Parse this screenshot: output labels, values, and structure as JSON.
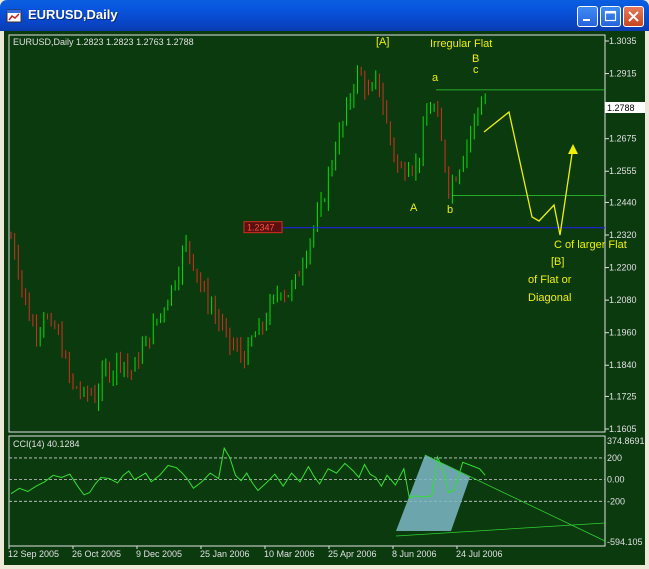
{
  "window": {
    "title": "EURUSD,Daily",
    "app_icon": "chart-window-icon",
    "buttons": [
      "minimize-icon",
      "maximize-icon",
      "close-icon"
    ]
  },
  "colors": {
    "background": "#0b3a0f",
    "bull": "#00e000",
    "bear": "#d03020",
    "annotation": "#f0f000",
    "support_line": "#2222dd",
    "cci_line": "#30e030",
    "cci_fill": "#7fb8c8"
  },
  "main_panel": {
    "header": "EURUSD,Daily  1.2823 1.2823 1.2763 1.2788",
    "price_ticks": [
      "1.3035",
      "1.2915",
      "1.2788",
      "1.2675",
      "1.2555",
      "1.2440",
      "1.2320",
      "1.2200",
      "1.2080",
      "1.1960",
      "1.1840",
      "1.1725",
      "1.1605"
    ],
    "current_price": "1.2788",
    "hline_label": "1.2347",
    "annotations": {
      "wave_A_bracket": "[A]",
      "irregular_flat": "Irregular Flat",
      "wave_a": "a",
      "wave_b_upper": "B",
      "wave_c": "c",
      "wave_A": "A",
      "wave_b": "b",
      "c_larger_flat": "C of larger Flat",
      "wave_B_bracket": "[B]",
      "of_flat_or": "of Flat or",
      "diagonal": "Diagonal"
    }
  },
  "cci_panel": {
    "header": "CCI(14) 40.1284",
    "ticks": [
      "374.8691",
      "200",
      "0.00",
      "-200",
      "-594.105"
    ]
  },
  "x_axis": {
    "dates": [
      "12 Sep 2005",
      "26 Oct 2005",
      "9 Dec 2005",
      "25 Jan 2006",
      "10 Mar 2006",
      "25 Apr 2006",
      "8 Jun 2006",
      "24 Jul 2006"
    ]
  },
  "chart_data": {
    "type": "candlestick",
    "symbol": "EURUSD",
    "timeframe": "Daily",
    "ylim": [
      1.1605,
      1.3035
    ],
    "cci_ylim": [
      -594.105,
      374.8691
    ],
    "horizontal_line": 1.2347,
    "path": [
      [
        0,
        1.231
      ],
      [
        4,
        1.224
      ],
      [
        8,
        1.212
      ],
      [
        12,
        1.204
      ],
      [
        16,
        1.198
      ],
      [
        20,
        1.197
      ],
      [
        24,
        1.205
      ],
      [
        28,
        1.196
      ],
      [
        32,
        1.198
      ],
      [
        36,
        1.191
      ],
      [
        40,
        1.183
      ],
      [
        44,
        1.175
      ],
      [
        48,
        1.176
      ],
      [
        52,
        1.172
      ],
      [
        56,
        1.175
      ],
      [
        60,
        1.172
      ],
      [
        64,
        1.178
      ],
      [
        68,
        1.183
      ],
      [
        72,
        1.181
      ],
      [
        76,
        1.187
      ],
      [
        80,
        1.186
      ],
      [
        84,
        1.181
      ],
      [
        88,
        1.183
      ],
      [
        92,
        1.189
      ],
      [
        96,
        1.192
      ],
      [
        100,
        1.196
      ],
      [
        104,
        1.201
      ],
      [
        108,
        1.204
      ],
      [
        112,
        1.21
      ],
      [
        116,
        1.214
      ],
      [
        120,
        1.221
      ],
      [
        124,
        1.229
      ],
      [
        128,
        1.225
      ],
      [
        132,
        1.219
      ],
      [
        136,
        1.212
      ],
      [
        140,
        1.208
      ],
      [
        144,
        1.205
      ],
      [
        148,
        1.2
      ],
      [
        152,
        1.196
      ],
      [
        156,
        1.192
      ],
      [
        160,
        1.19
      ],
      [
        164,
        1.188
      ],
      [
        168,
        1.187
      ],
      [
        172,
        1.194
      ],
      [
        176,
        1.196
      ],
      [
        180,
        1.199
      ],
      [
        184,
        1.205
      ],
      [
        188,
        1.208
      ],
      [
        192,
        1.213
      ],
      [
        196,
        1.21
      ],
      [
        200,
        1.212
      ],
      [
        204,
        1.216
      ],
      [
        208,
        1.223
      ],
      [
        212,
        1.229
      ],
      [
        216,
        1.235
      ],
      [
        220,
        1.24
      ],
      [
        224,
        1.248
      ],
      [
        228,
        1.258
      ],
      [
        232,
        1.266
      ],
      [
        236,
        1.272
      ],
      [
        240,
        1.279
      ],
      [
        244,
        1.288
      ],
      [
        248,
        1.292
      ],
      [
        252,
        1.288
      ],
      [
        256,
        1.282
      ],
      [
        260,
        1.289
      ],
      [
        264,
        1.284
      ],
      [
        268,
        1.272
      ],
      [
        272,
        1.264
      ],
      [
        276,
        1.256
      ],
      [
        280,
        1.256
      ],
      [
        284,
        1.26
      ],
      [
        288,
        1.256
      ],
      [
        292,
        1.264
      ],
      [
        296,
        1.276
      ],
      [
        300,
        1.281
      ],
      [
        304,
        1.274
      ],
      [
        308,
        1.262
      ],
      [
        312,
        1.25
      ],
      [
        316,
        1.253
      ],
      [
        320,
        1.258
      ],
      [
        324,
        1.265
      ],
      [
        328,
        1.271
      ],
      [
        332,
        1.277
      ],
      [
        336,
        1.283
      ],
      [
        340,
        1.279
      ]
    ],
    "cci": [
      [
        0,
        -130
      ],
      [
        6,
        -80
      ],
      [
        12,
        -110
      ],
      [
        18,
        -60
      ],
      [
        24,
        -20
      ],
      [
        30,
        40
      ],
      [
        36,
        20
      ],
      [
        42,
        50
      ],
      [
        48,
        -70
      ],
      [
        52,
        -140
      ],
      [
        56,
        -120
      ],
      [
        60,
        -40
      ],
      [
        64,
        20
      ],
      [
        70,
        10
      ],
      [
        76,
        -30
      ],
      [
        80,
        40
      ],
      [
        84,
        80
      ],
      [
        88,
        0
      ],
      [
        92,
        30
      ],
      [
        96,
        60
      ],
      [
        100,
        -20
      ],
      [
        106,
        40
      ],
      [
        112,
        130
      ],
      [
        118,
        110
      ],
      [
        122,
        60
      ],
      [
        126,
        0
      ],
      [
        130,
        -80
      ],
      [
        136,
        -20
      ],
      [
        142,
        60
      ],
      [
        148,
        10
      ],
      [
        152,
        290
      ],
      [
        156,
        200
      ],
      [
        160,
        40
      ],
      [
        164,
        -10
      ],
      [
        168,
        60
      ],
      [
        172,
        -30
      ],
      [
        176,
        -100
      ],
      [
        182,
        -30
      ],
      [
        188,
        50
      ],
      [
        194,
        -60
      ],
      [
        200,
        60
      ],
      [
        206,
        -20
      ],
      [
        212,
        120
      ],
      [
        216,
        30
      ],
      [
        220,
        -40
      ],
      [
        226,
        100
      ],
      [
        232,
        60
      ],
      [
        238,
        150
      ],
      [
        244,
        80
      ],
      [
        248,
        20
      ],
      [
        252,
        140
      ],
      [
        256,
        50
      ],
      [
        260,
        20
      ],
      [
        264,
        -60
      ],
      [
        268,
        40
      ],
      [
        274,
        -50
      ],
      [
        280,
        100
      ],
      [
        284,
        -170
      ],
      [
        288,
        -150
      ],
      [
        294,
        -160
      ],
      [
        300,
        -150
      ],
      [
        304,
        210
      ],
      [
        308,
        90
      ],
      [
        312,
        -120
      ],
      [
        316,
        -100
      ],
      [
        322,
        160
      ],
      [
        328,
        130
      ],
      [
        334,
        100
      ],
      [
        338,
        40
      ]
    ],
    "trendlines": {
      "price_a_b_upper": 1.2855,
      "price_a_b_lower": 1.2465
    }
  }
}
